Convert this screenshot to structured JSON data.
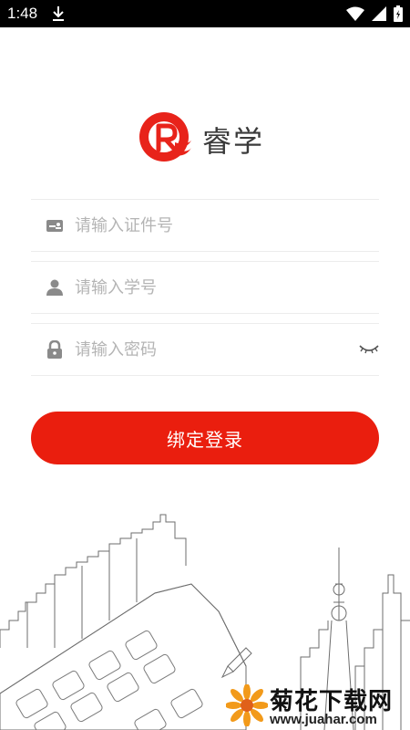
{
  "status_bar": {
    "time": "1:48",
    "icons": [
      "download-icon",
      "wifi-icon",
      "signal-icon",
      "battery-icon"
    ]
  },
  "app": {
    "name": "睿学",
    "brand_color": "#ea1e0e"
  },
  "form": {
    "id_card": {
      "placeholder": "请输入证件号",
      "value": "",
      "icon": "id-card-icon"
    },
    "student_no": {
      "placeholder": "请输入学号",
      "value": "",
      "icon": "user-icon"
    },
    "password": {
      "placeholder": "请输入密码",
      "value": "",
      "icon": "lock-icon",
      "toggle_icon": "eye-closed-icon"
    },
    "submit_label": "绑定登录"
  },
  "watermark": {
    "title": "菊花下载网",
    "url": "www.juahar.com"
  }
}
